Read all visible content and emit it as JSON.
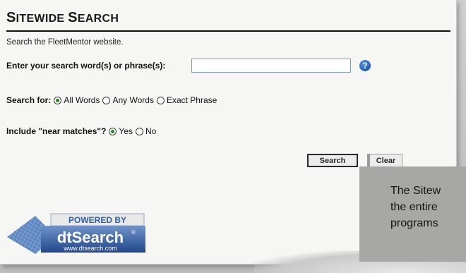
{
  "page": {
    "title_first_big": "S",
    "title_first_small": "ITEWIDE",
    "title_second_big": "S",
    "title_second_small": "EARCH",
    "intro": "Search the FleetMentor website."
  },
  "form": {
    "query_label": "Enter your search word(s) or phrase(s):",
    "query_value": "",
    "help_icon": "question-circle-icon",
    "search_for_label": "Search for:",
    "search_for_options": [
      "All Words",
      "Any Words",
      "Exact Phrase"
    ],
    "search_for_selected": "All Words",
    "near_label": "Include \"near matches\"?",
    "near_options": [
      "Yes",
      "No"
    ],
    "near_selected": "Yes",
    "search_button": "Search",
    "clear_button": "Clear"
  },
  "logo": {
    "line1": "POWERED BY",
    "line2": "dtSearch",
    "line3": "www.dtsearch.com",
    "trademark": "®"
  },
  "tooltip": {
    "line1": "The Sitew",
    "line2": "the entire",
    "line3": "programs"
  },
  "colors": {
    "radio_selected": "#1b8a1b",
    "input_border": "#7f9db9",
    "help_icon": "#1447a8",
    "tooltip_bg": "#a7a7a5",
    "logo_blue": "#2f5fa6"
  }
}
